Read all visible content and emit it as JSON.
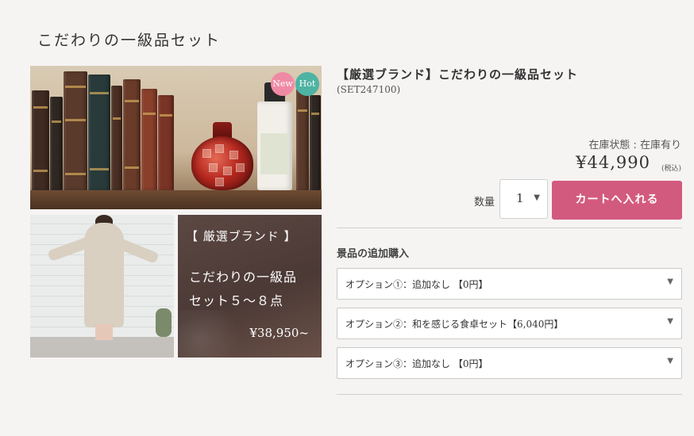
{
  "page": {
    "title": "こだわりの一級品セット"
  },
  "gallery": {
    "badges": {
      "new": "New",
      "hot": "Hot"
    },
    "promo": {
      "tag": "【 厳選ブランド 】",
      "title_line1": "こだわりの一級品",
      "title_line2": "セット５～８点",
      "price": "¥38,950~"
    }
  },
  "product": {
    "name": "【厳選ブランド】こだわりの一級品セット",
    "code": "(SET247100)",
    "stock": "在庫状態 : 在庫有り",
    "price": "¥44,990",
    "tax_note": "(税込)"
  },
  "purchase": {
    "quantity_label": "数量",
    "quantity_value": "1",
    "cart_button": "カートへ入れる"
  },
  "extras": {
    "heading": "景品の追加購入",
    "options": [
      {
        "label": "オプション①：追加なし 【0円】"
      },
      {
        "label": "オプション②：和を感じる食卓セット【6,040円】"
      },
      {
        "label": "オプション③：追加なし 【0円】"
      }
    ]
  },
  "colors": {
    "accent": "#d35a7f",
    "badge_new": "#f08aa4",
    "badge_hot": "#4db3a3"
  },
  "icons": {
    "dropdown": "chevron-down-icon"
  }
}
